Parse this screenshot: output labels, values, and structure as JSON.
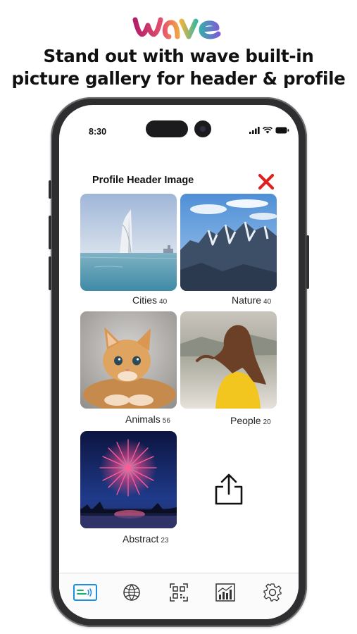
{
  "brand": {
    "logo_text": "wave"
  },
  "promo": {
    "headline_line1": "Stand out with wave built-in",
    "headline_line2": "picture gallery for header & profile"
  },
  "status_bar": {
    "time": "8:30",
    "icons": [
      "signal-icon",
      "wifi-icon",
      "battery-icon"
    ]
  },
  "sheet": {
    "title": "Profile Header Image",
    "close_icon": "close-x-icon",
    "close_color": "#e02020",
    "categories": [
      {
        "label": "Cities",
        "count": "40"
      },
      {
        "label": "Nature",
        "count": "40"
      },
      {
        "label": "Animals",
        "count": "56"
      },
      {
        "label": "People",
        "count": "20"
      },
      {
        "label": "Abstract",
        "count": "23"
      }
    ],
    "share_icon": "share-upload-icon"
  },
  "tab_bar": {
    "accent": "#1a8fe3",
    "tabs": [
      {
        "icon": "wave-card-icon",
        "active": true
      },
      {
        "icon": "globe-icon",
        "active": false
      },
      {
        "icon": "qr-code-icon",
        "active": false
      },
      {
        "icon": "analytics-chart-icon",
        "active": false
      },
      {
        "icon": "settings-gear-icon",
        "active": false
      }
    ]
  }
}
